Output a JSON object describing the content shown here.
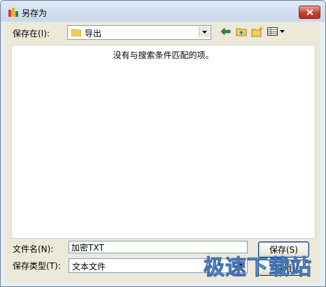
{
  "window": {
    "title": "另存为"
  },
  "toolbar": {
    "look_in_label": "保存在(I):",
    "folder": "导出",
    "icons": [
      "back-arrow-icon",
      "up-folder-icon",
      "new-folder-icon",
      "view-menu-icon"
    ]
  },
  "file_list": {
    "empty_message": "没有与搜索条件匹配的项。"
  },
  "form": {
    "file_name_label": "文件名(N):",
    "file_name_value": "加密TXT",
    "file_type_label": "保存类型(T):",
    "file_type_value": "文本文件"
  },
  "buttons": {
    "save": "保存(S)",
    "cancel": "取消"
  },
  "watermark": "极速下载站",
  "colors": {
    "title_gradient_top": "#dfe9f6",
    "close_red": "#c4412f",
    "face": "#ece9d8"
  }
}
